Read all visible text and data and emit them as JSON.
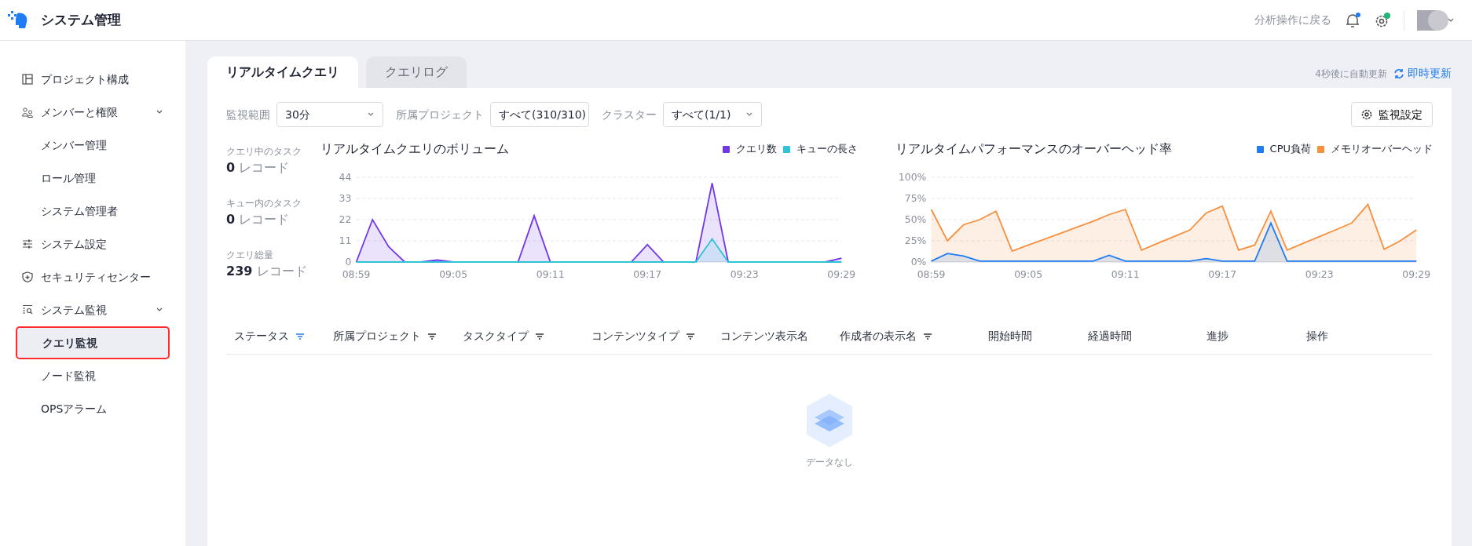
{
  "header": {
    "title": "システム管理",
    "back_link": "分析操作に戻る",
    "notification_dot": true,
    "settings_badge": true
  },
  "sidebar": {
    "items": [
      {
        "kind": "item",
        "label": "プロジェクト構成",
        "selected": false
      },
      {
        "kind": "group",
        "label": "メンバーと権限",
        "expanded": true,
        "children": [
          {
            "label": "メンバー管理",
            "selected": false
          },
          {
            "label": "ロール管理",
            "selected": false
          },
          {
            "label": "システム管理者",
            "selected": false
          }
        ]
      },
      {
        "kind": "item",
        "label": "システム設定",
        "selected": false
      },
      {
        "kind": "item",
        "label": "セキュリティセンター",
        "selected": false
      },
      {
        "kind": "group",
        "label": "システム監視",
        "expanded": true,
        "children": [
          {
            "label": "クエリ監視",
            "selected": true
          },
          {
            "label": "ノード監視",
            "selected": false
          },
          {
            "label": "OPSアラーム",
            "selected": false
          }
        ]
      }
    ]
  },
  "tabs": [
    {
      "label": "リアルタイムクエリ",
      "selected": true
    },
    {
      "label": "クエリログ",
      "selected": false
    }
  ],
  "auto_refresh": "4秒後に自動更新",
  "refresh_button": "即時更新",
  "filters": [
    {
      "label": "監視範囲",
      "value": "30分"
    },
    {
      "label": "所属プロジェクト",
      "value": "すべて(310/310)"
    },
    {
      "label": "クラスター",
      "value": "すべて(1/1)"
    }
  ],
  "settings_button": "監視設定",
  "stats": [
    {
      "label": "クエリ中のタスク",
      "value": "0",
      "unit": "レコード"
    },
    {
      "label": "キュー内のタスク",
      "value": "0",
      "unit": "レコード"
    },
    {
      "label": "クエリ総量",
      "value": "239",
      "unit": "レコード"
    }
  ],
  "charts": [
    {
      "chart_data": {
        "type": "area",
        "title": "リアルタイムクエリのボリューム",
        "grid": true,
        "categories": [
          "08:59",
          null,
          null,
          null,
          null,
          null,
          "09:05",
          null,
          null,
          null,
          null,
          null,
          "09:11",
          null,
          null,
          null,
          null,
          null,
          "09:17",
          null,
          null,
          null,
          null,
          null,
          "09:23",
          null,
          null,
          null,
          null,
          null,
          "09:29"
        ],
        "ylim": [
          0,
          44
        ],
        "yticks": [
          0,
          11,
          22,
          33,
          44
        ],
        "series": [
          {
            "name": "クエリ数",
            "color": "#7038e8",
            "values": [
              0,
              22,
              8,
              0,
              0,
              1,
              0,
              0,
              0,
              0,
              0,
              24,
              0,
              0,
              0,
              0,
              0,
              0,
              9,
              0,
              0,
              0,
              41,
              0,
              0,
              0,
              0,
              0,
              0,
              0,
              2
            ]
          },
          {
            "name": "キューの長さ",
            "color": "#2ec4d6",
            "values": [
              0,
              0,
              0,
              0,
              0,
              0,
              0,
              0,
              0,
              0,
              0,
              0,
              0,
              0,
              0,
              0,
              0,
              0,
              0,
              0,
              0,
              0,
              12,
              0,
              0,
              0,
              0,
              0,
              0,
              0,
              0
            ]
          }
        ]
      }
    },
    {
      "chart_data": {
        "type": "area",
        "title": "リアルタイムパフォーマンスのオーバーヘッド率",
        "grid": true,
        "categories": [
          "08:59",
          null,
          null,
          null,
          null,
          null,
          "09:05",
          null,
          null,
          null,
          null,
          null,
          "09:11",
          null,
          null,
          null,
          null,
          null,
          "09:17",
          null,
          null,
          null,
          null,
          null,
          "09:23",
          null,
          null,
          null,
          null,
          null,
          "09:29"
        ],
        "ylim": [
          0,
          100
        ],
        "yticks": [
          {
            "value": 0,
            "label": "0%"
          },
          {
            "value": 25,
            "label": "25%"
          },
          {
            "value": 50,
            "label": "50%"
          },
          {
            "value": 75,
            "label": "75%"
          },
          {
            "value": 100,
            "label": "100%"
          }
        ],
        "series": [
          {
            "name": "CPU負荷",
            "color": "#1f7cf2",
            "values": [
              1,
              10,
              7,
              1,
              1,
              1,
              1,
              1,
              1,
              1,
              1,
              8,
              1,
              1,
              1,
              1,
              1,
              4,
              1,
              1,
              1,
              46,
              1,
              1,
              1,
              1,
              1,
              1,
              1,
              1,
              1
            ]
          },
          {
            "name": "メモリオーバーヘッド",
            "color": "#f78f3d",
            "values": [
              62,
              25,
              44,
              50,
              60,
              13,
              20,
              27,
              34,
              41,
              48,
              56,
              62,
              14,
              22,
              30,
              38,
              58,
              66,
              14,
              20,
              60,
              14,
              22,
              30,
              38,
              46,
              68,
              15,
              25,
              38
            ]
          }
        ]
      }
    }
  ],
  "table": {
    "columns": [
      {
        "label": "ステータス",
        "filter": true,
        "filter_active": true
      },
      {
        "label": "所属プロジェクト",
        "filter": true,
        "filter_active": false
      },
      {
        "label": "タスクタイプ",
        "filter": true,
        "filter_active": false
      },
      {
        "label": "コンテンツタイプ",
        "filter": true,
        "filter_active": false
      },
      {
        "label": "コンテンツ表示名",
        "filter": false
      },
      {
        "label": "作成者の表示名",
        "filter": true,
        "filter_active": false
      },
      {
        "label": "開始時間",
        "filter": false
      },
      {
        "label": "経過時間",
        "filter": false
      },
      {
        "label": "進捗",
        "filter": false
      },
      {
        "label": "操作",
        "filter": false
      }
    ],
    "empty_text": "データなし"
  }
}
